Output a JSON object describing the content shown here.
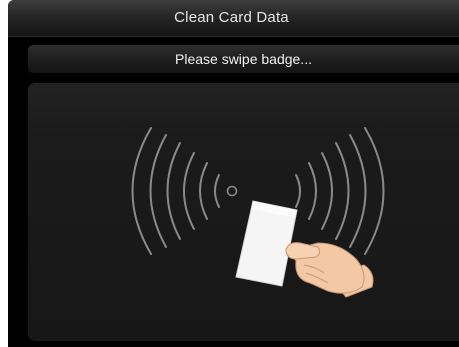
{
  "window": {
    "title": "Clean Card Data"
  },
  "prompt": {
    "text": "Please swipe badge..."
  },
  "illustration": {
    "icon": "card-swipe-icon",
    "elements": [
      "rfid-waves-icon",
      "badge-card-icon",
      "hand-icon"
    ]
  },
  "colors": {
    "background": "#000000",
    "title_text": "#e6e6e6",
    "prompt_text": "#f2f2f2",
    "panel": "#1b1b1b",
    "waves": "#8a8a8a",
    "card": "#f4f4f4",
    "hand": "#f3c9a5"
  }
}
